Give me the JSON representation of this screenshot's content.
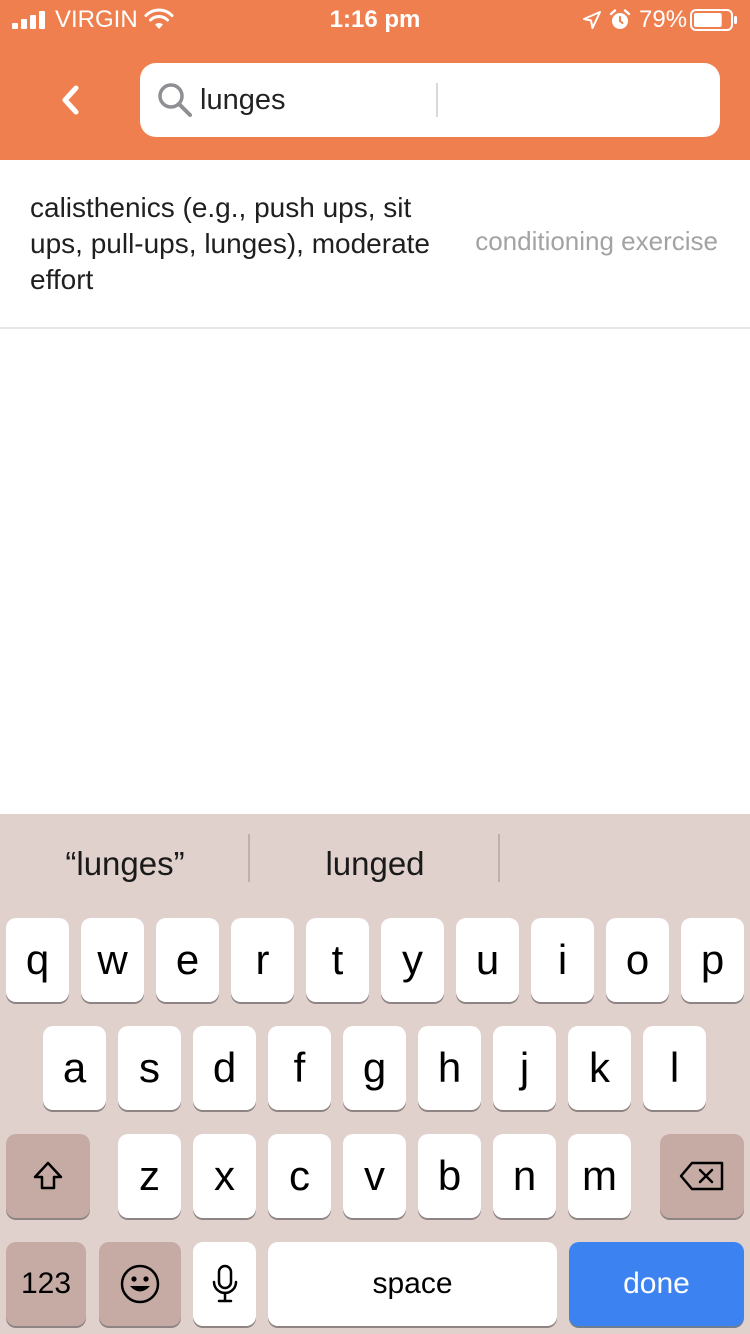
{
  "status_bar": {
    "carrier": "VIRGIN",
    "time": "1:16 pm",
    "battery_percent": "79%",
    "battery_level": 0.79,
    "icons": [
      "signal-icon",
      "wifi-icon",
      "location-arrow-icon",
      "alarm-icon",
      "battery-icon"
    ]
  },
  "header": {
    "background_color": "#ef7f4f",
    "search": {
      "value": "lunges",
      "icon": "search-icon"
    },
    "back_icon": "chevron-left-icon"
  },
  "results": [
    {
      "title": "calisthenics (e.g., push ups, sit ups, pull-ups, lunges), moderate effort",
      "category": "conditioning exercise"
    }
  ],
  "keyboard": {
    "suggestions": [
      "“lunges”",
      "lunged",
      ""
    ],
    "row1": [
      "q",
      "w",
      "e",
      "r",
      "t",
      "y",
      "u",
      "i",
      "o",
      "p"
    ],
    "row2": [
      "a",
      "s",
      "d",
      "f",
      "g",
      "h",
      "j",
      "k",
      "l"
    ],
    "row3": [
      "z",
      "x",
      "c",
      "v",
      "b",
      "n",
      "m"
    ],
    "numbers_label": "123",
    "space_label": "space",
    "done_label": "done",
    "done_color": "#3c82f0"
  }
}
